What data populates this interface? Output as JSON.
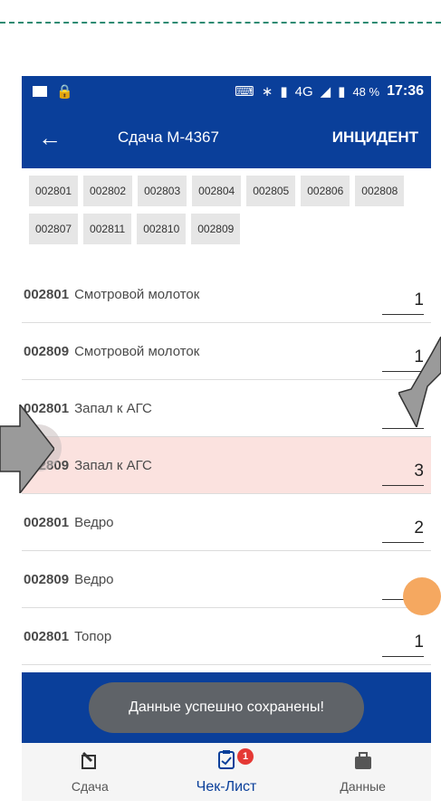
{
  "status_bar": {
    "battery_pct": "48 %",
    "time": "17:36",
    "network": "4G"
  },
  "toolbar": {
    "back_icon": "arrow-left-icon",
    "title": "Сдача М-4367",
    "action": "ИНЦИДЕНТ"
  },
  "chips": [
    "002801",
    "002802",
    "002803",
    "002804",
    "002805",
    "002806",
    "002808",
    "002807",
    "002811",
    "002810",
    "002809"
  ],
  "items": [
    {
      "code": "002801",
      "name": "Смотровой молоток",
      "qty": "1",
      "highlight": false
    },
    {
      "code": "002809",
      "name": "Смотровой молоток",
      "qty": "1",
      "highlight": false
    },
    {
      "code": "002801",
      "name": "Запал к АГС",
      "qty": "",
      "highlight": false
    },
    {
      "code": "002809",
      "name": "Запал к АГС",
      "qty": "3",
      "highlight": true
    },
    {
      "code": "002801",
      "name": "Ведро",
      "qty": "2",
      "highlight": false
    },
    {
      "code": "002809",
      "name": "Ведро",
      "qty": "2",
      "highlight": false
    },
    {
      "code": "002801",
      "name": "Топор",
      "qty": "1",
      "highlight": false
    }
  ],
  "toast": "Данные успешно сохранены!",
  "bottom_nav": [
    {
      "label": "Сдача",
      "icon": "edit-icon",
      "active": false
    },
    {
      "label": "Чек-Лист",
      "icon": "clipboard-check-icon",
      "active": true,
      "badge": "1"
    },
    {
      "label": "Данные",
      "icon": "briefcase-icon",
      "active": false
    }
  ],
  "colors": {
    "primary": "#0a3f9a",
    "highlight_row": "#fbe2df",
    "badge": "#e53935",
    "toast_bg": "#5f6368"
  }
}
